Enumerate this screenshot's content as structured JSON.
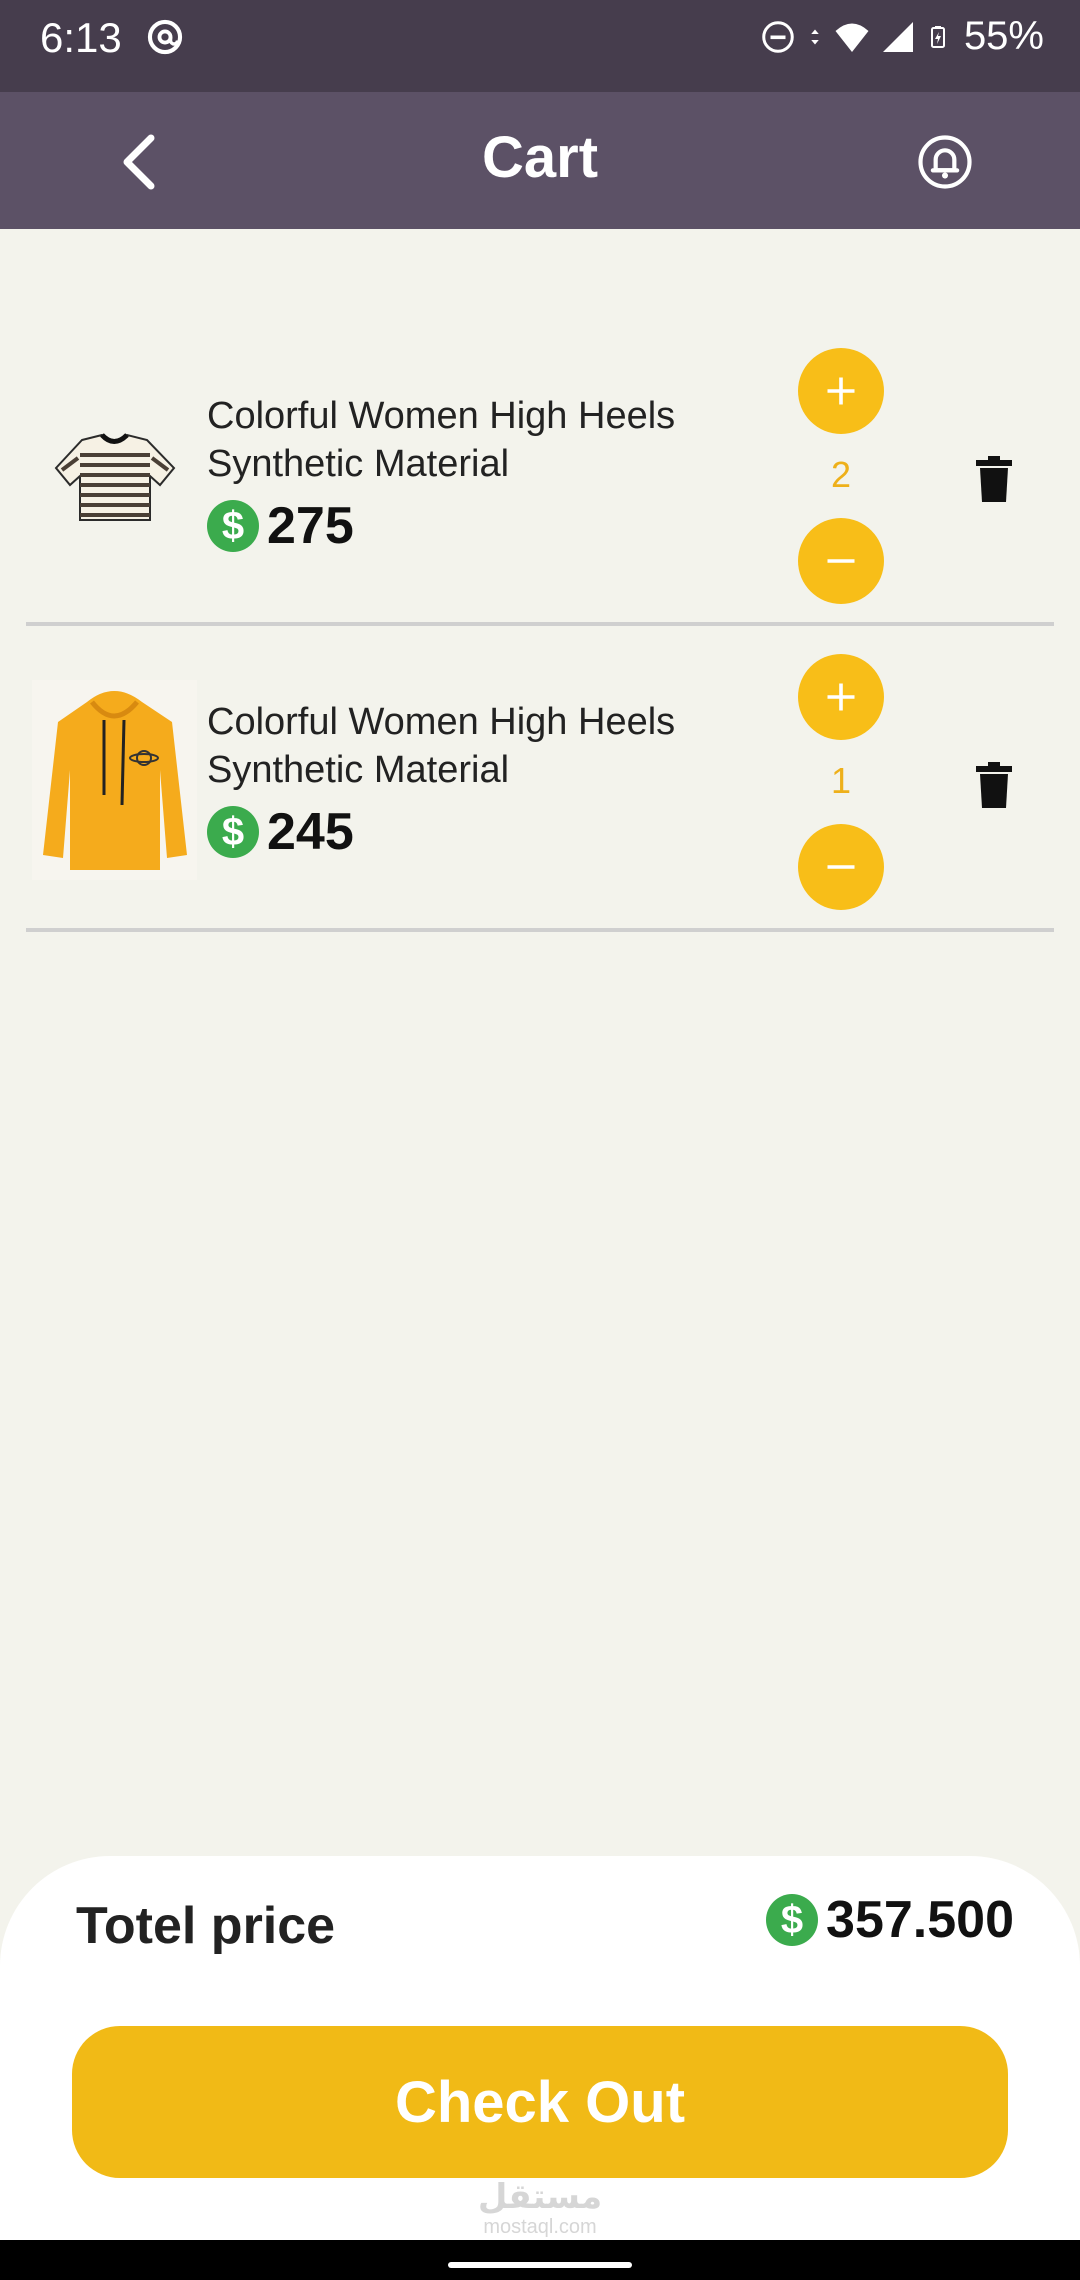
{
  "status_bar": {
    "time": "6:13",
    "battery": "55%",
    "icons": [
      "at-icon",
      "dnd-icon",
      "data-arrows-icon",
      "wifi-icon",
      "signal-icon",
      "battery-charging-icon"
    ]
  },
  "app_bar": {
    "title": "Cart",
    "back_icon": "chevron-left-icon",
    "notification_icon": "bell-icon"
  },
  "cart": {
    "items": [
      {
        "image": "striped-crop-tee-image",
        "name_line1": "Colorful Women High Heels",
        "name_line2": "Synthetic Material",
        "currency_symbol": "$",
        "price": "275",
        "quantity": "2"
      },
      {
        "image": "yellow-hoodie-image",
        "name_line1": "Colorful Women High Heels",
        "name_line2": "Synthetic Material",
        "currency_symbol": "$",
        "price": "245",
        "quantity": "1"
      }
    ]
  },
  "summary": {
    "total_label": "Totel price",
    "currency_symbol": "$",
    "total_value": "357.500",
    "checkout_label": "Check Out"
  },
  "watermark": {
    "arabic": "مستقل",
    "site": "mostaql.com"
  },
  "colors": {
    "status_bar": "#463d4d",
    "app_bar": "#5c5166",
    "background": "#f3f3ec",
    "accent_yellow": "#f8be18",
    "checkout_yellow": "#f1ba16",
    "dollar_green": "#3bab4d"
  }
}
